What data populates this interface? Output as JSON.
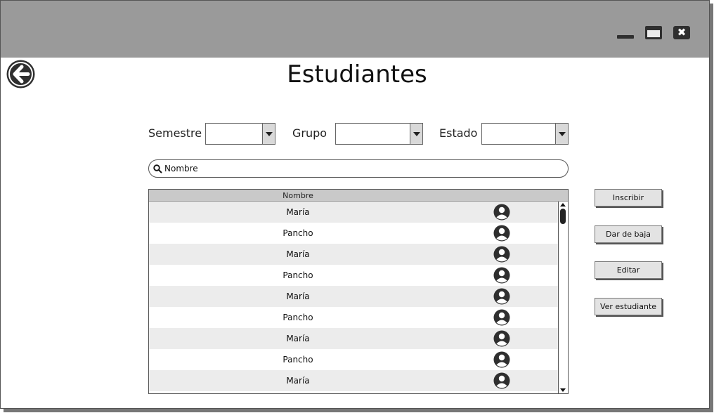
{
  "window": {
    "controls": {
      "minimize_icon": "minimize-icon",
      "maximize_icon": "maximize-icon",
      "close_icon": "close-icon",
      "close_glyph": "✖"
    }
  },
  "header": {
    "title": "Estudiantes",
    "back_icon": "back-arrow-icon"
  },
  "filters": {
    "semestre": {
      "label": "Semestre",
      "value": ""
    },
    "grupo": {
      "label": "Grupo",
      "value": ""
    },
    "estado": {
      "label": "Estado",
      "value": ""
    }
  },
  "search": {
    "placeholder": "Nombre"
  },
  "table": {
    "columns": [
      "Nombre",
      ""
    ],
    "rows": [
      {
        "name": "María"
      },
      {
        "name": "Pancho"
      },
      {
        "name": "María"
      },
      {
        "name": "Pancho"
      },
      {
        "name": "María"
      },
      {
        "name": "Pancho"
      },
      {
        "name": "María"
      },
      {
        "name": "Pancho"
      },
      {
        "name": "María"
      }
    ]
  },
  "actions": {
    "inscribir": "Inscribir",
    "dar_de_baja": "Dar de baja",
    "editar": "Editar",
    "ver_estudiante": "Ver estudiante"
  },
  "colors": {
    "titlebar": "#9a9a9a",
    "icon_dark": "#2f2f2f",
    "row_alt": "#ececec"
  }
}
